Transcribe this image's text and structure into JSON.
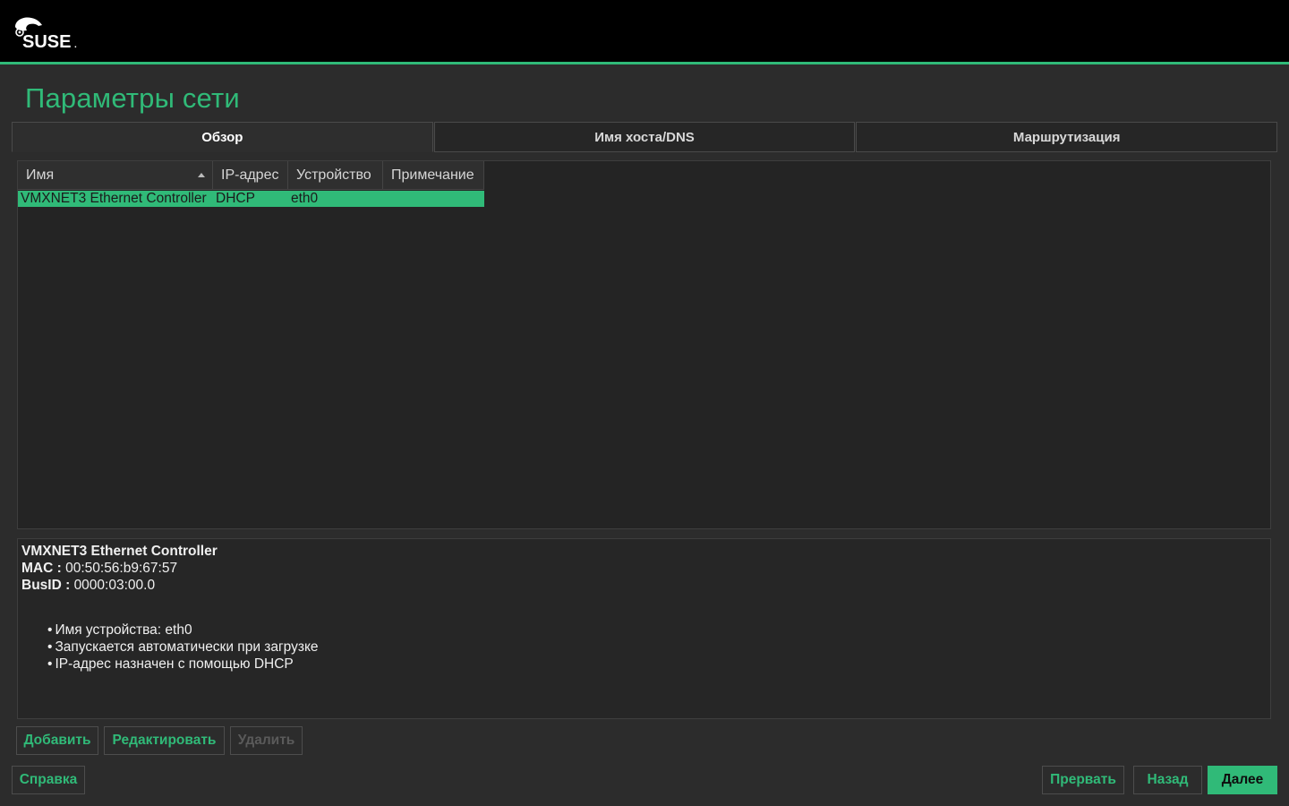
{
  "header": {
    "logo_text": "SUSE",
    "accent_color": "#30ba78"
  },
  "page": {
    "title": "Параметры сети"
  },
  "tabs": [
    {
      "label": "Обзор",
      "active": true
    },
    {
      "label": "Имя хоста/DNS",
      "active": false
    },
    {
      "label": "Маршрутизация",
      "active": false
    }
  ],
  "table": {
    "columns": [
      "Имя",
      "IP-адрес",
      "Устройство",
      "Примечание"
    ],
    "rows": [
      {
        "name": "VMXNET3 Ethernet Controller",
        "ip": "DHCP",
        "device": "eth0",
        "note": ""
      }
    ]
  },
  "details": {
    "title": "VMXNET3 Ethernet Controller",
    "mac_label": "MAC :",
    "mac_value": "00:50:56:b9:67:57",
    "busid_label": "BusID :",
    "busid_value": "0000:03:00.0",
    "bullets": [
      "Имя устройства: eth0",
      "Запускается автоматически при загрузке",
      "IP-адрес назначен с помощью DHCP"
    ]
  },
  "actions": {
    "add": "Добавить",
    "edit": "Редактировать",
    "delete": "Удалить"
  },
  "footer": {
    "help": "Справка",
    "abort": "Прервать",
    "back": "Назад",
    "next": "Далее"
  }
}
